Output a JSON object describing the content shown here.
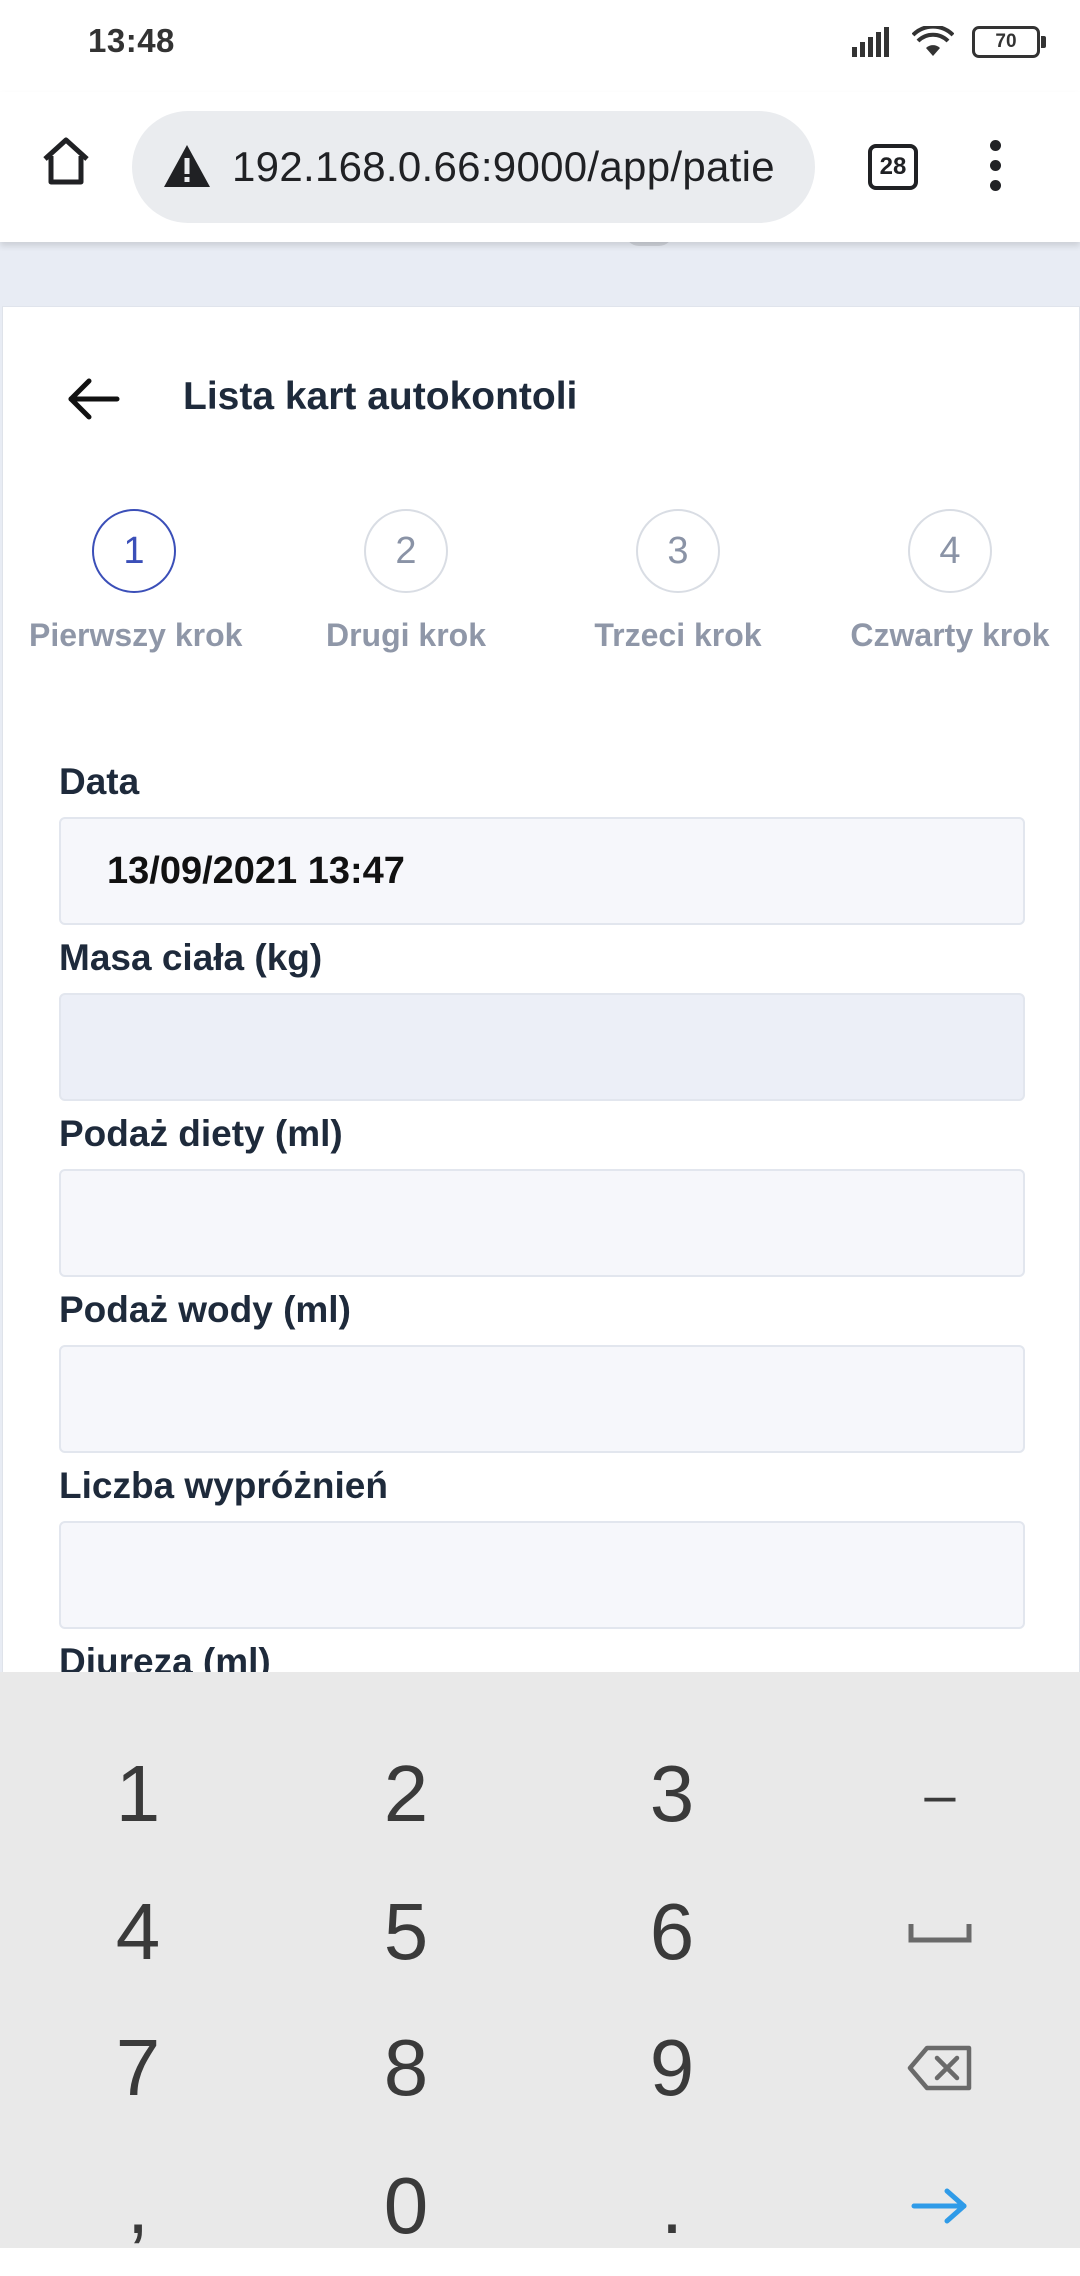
{
  "status_bar": {
    "time": "13:48",
    "battery": "70"
  },
  "browser": {
    "url": "192.168.0.66:9000/app/patie",
    "tab_count": "28"
  },
  "header": {
    "title": "Lista kart autokontoli"
  },
  "steps": [
    {
      "number": "1",
      "label": "Pierwszy krok",
      "active": true
    },
    {
      "number": "2",
      "label": "Drugi krok",
      "active": false
    },
    {
      "number": "3",
      "label": "Trzeci krok",
      "active": false
    },
    {
      "number": "4",
      "label": "Czwarty krok",
      "active": false
    }
  ],
  "form": {
    "date": {
      "label": "Data",
      "value": "13/09/2021 13:47"
    },
    "body_mass": {
      "label": "Masa ciała (kg)",
      "value": ""
    },
    "diet_intake": {
      "label": "Podaż diety (ml)",
      "value": ""
    },
    "water_intake": {
      "label": "Podaż wody (ml)",
      "value": ""
    },
    "bowel_movements": {
      "label": "Liczba wypróżnień",
      "value": ""
    },
    "diuresis": {
      "label": "Diureza (ml)"
    }
  },
  "keyboard": {
    "keys": [
      "1",
      "2",
      "3",
      "–",
      "4",
      "5",
      "6",
      "␣",
      "7",
      "8",
      "9",
      "⌫",
      ",",
      "0",
      ".",
      "→"
    ]
  },
  "colors": {
    "accent": "#3b4fb8",
    "enter_key": "#2f9be8",
    "keyboard_bg": "#e9e9e9"
  }
}
